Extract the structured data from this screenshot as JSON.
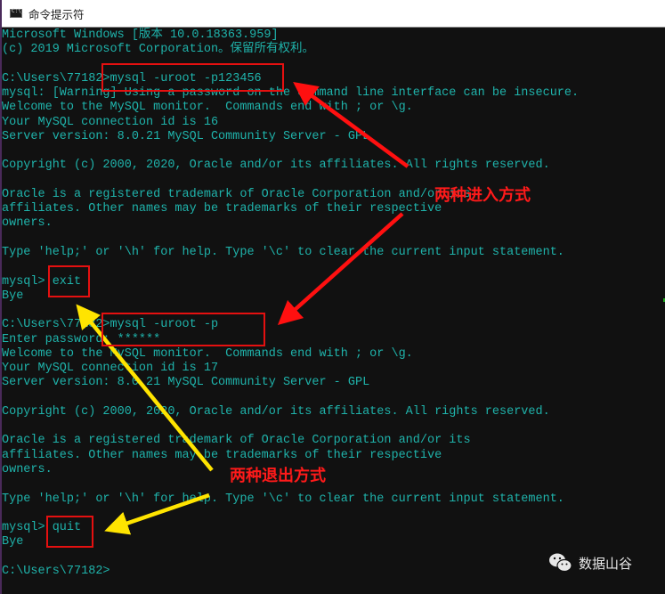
{
  "window": {
    "title": "命令提示符",
    "icon": "cmd-icon"
  },
  "terminal": {
    "lines": [
      "Microsoft Windows [版本 10.0.18363.959]",
      "(c) 2019 Microsoft Corporation。保留所有权利。",
      "",
      "C:\\Users\\77182>mysql -uroot -p123456",
      "mysql: [Warning] Using a password on the command line interface can be insecure.",
      "Welcome to the MySQL monitor.  Commands end with ; or \\g.",
      "Your MySQL connection id is 16",
      "Server version: 8.0.21 MySQL Community Server - GPL",
      "",
      "Copyright (c) 2000, 2020, Oracle and/or its affiliates. All rights reserved.",
      "",
      "Oracle is a registered trademark of Oracle Corporation and/or its",
      "affiliates. Other names may be trademarks of their respective",
      "owners.",
      "",
      "Type 'help;' or '\\h' for help. Type '\\c' to clear the current input statement.",
      "",
      "mysql> exit",
      "Bye",
      "",
      "C:\\Users\\77182>mysql -uroot -p",
      "Enter password: ******",
      "Welcome to the MySQL monitor.  Commands end with ; or \\g.",
      "Your MySQL connection id is 17",
      "Server version: 8.0.21 MySQL Community Server - GPL",
      "",
      "Copyright (c) 2000, 2020, Oracle and/or its affiliates. All rights reserved.",
      "",
      "Oracle is a registered trademark of Oracle Corporation and/or its",
      "affiliates. Other names may be trademarks of their respective",
      "owners.",
      "",
      "Type 'help;' or '\\h' for help. Type '\\c' to clear the current input statement.",
      "",
      "mysql> quit",
      "Bye",
      "",
      "C:\\Users\\77182>"
    ]
  },
  "annotations": {
    "enter_label": "两种进入方式",
    "exit_label": "两种退出方式",
    "red_color": "#e51010",
    "yellow_color": "#ffe400"
  },
  "watermark": {
    "icon": "wechat-icon",
    "text": "数据山谷"
  },
  "colors": {
    "terminal_bg": "#111111",
    "terminal_text": "#1fb3ab",
    "titlebar_bg": "#ffffff"
  }
}
